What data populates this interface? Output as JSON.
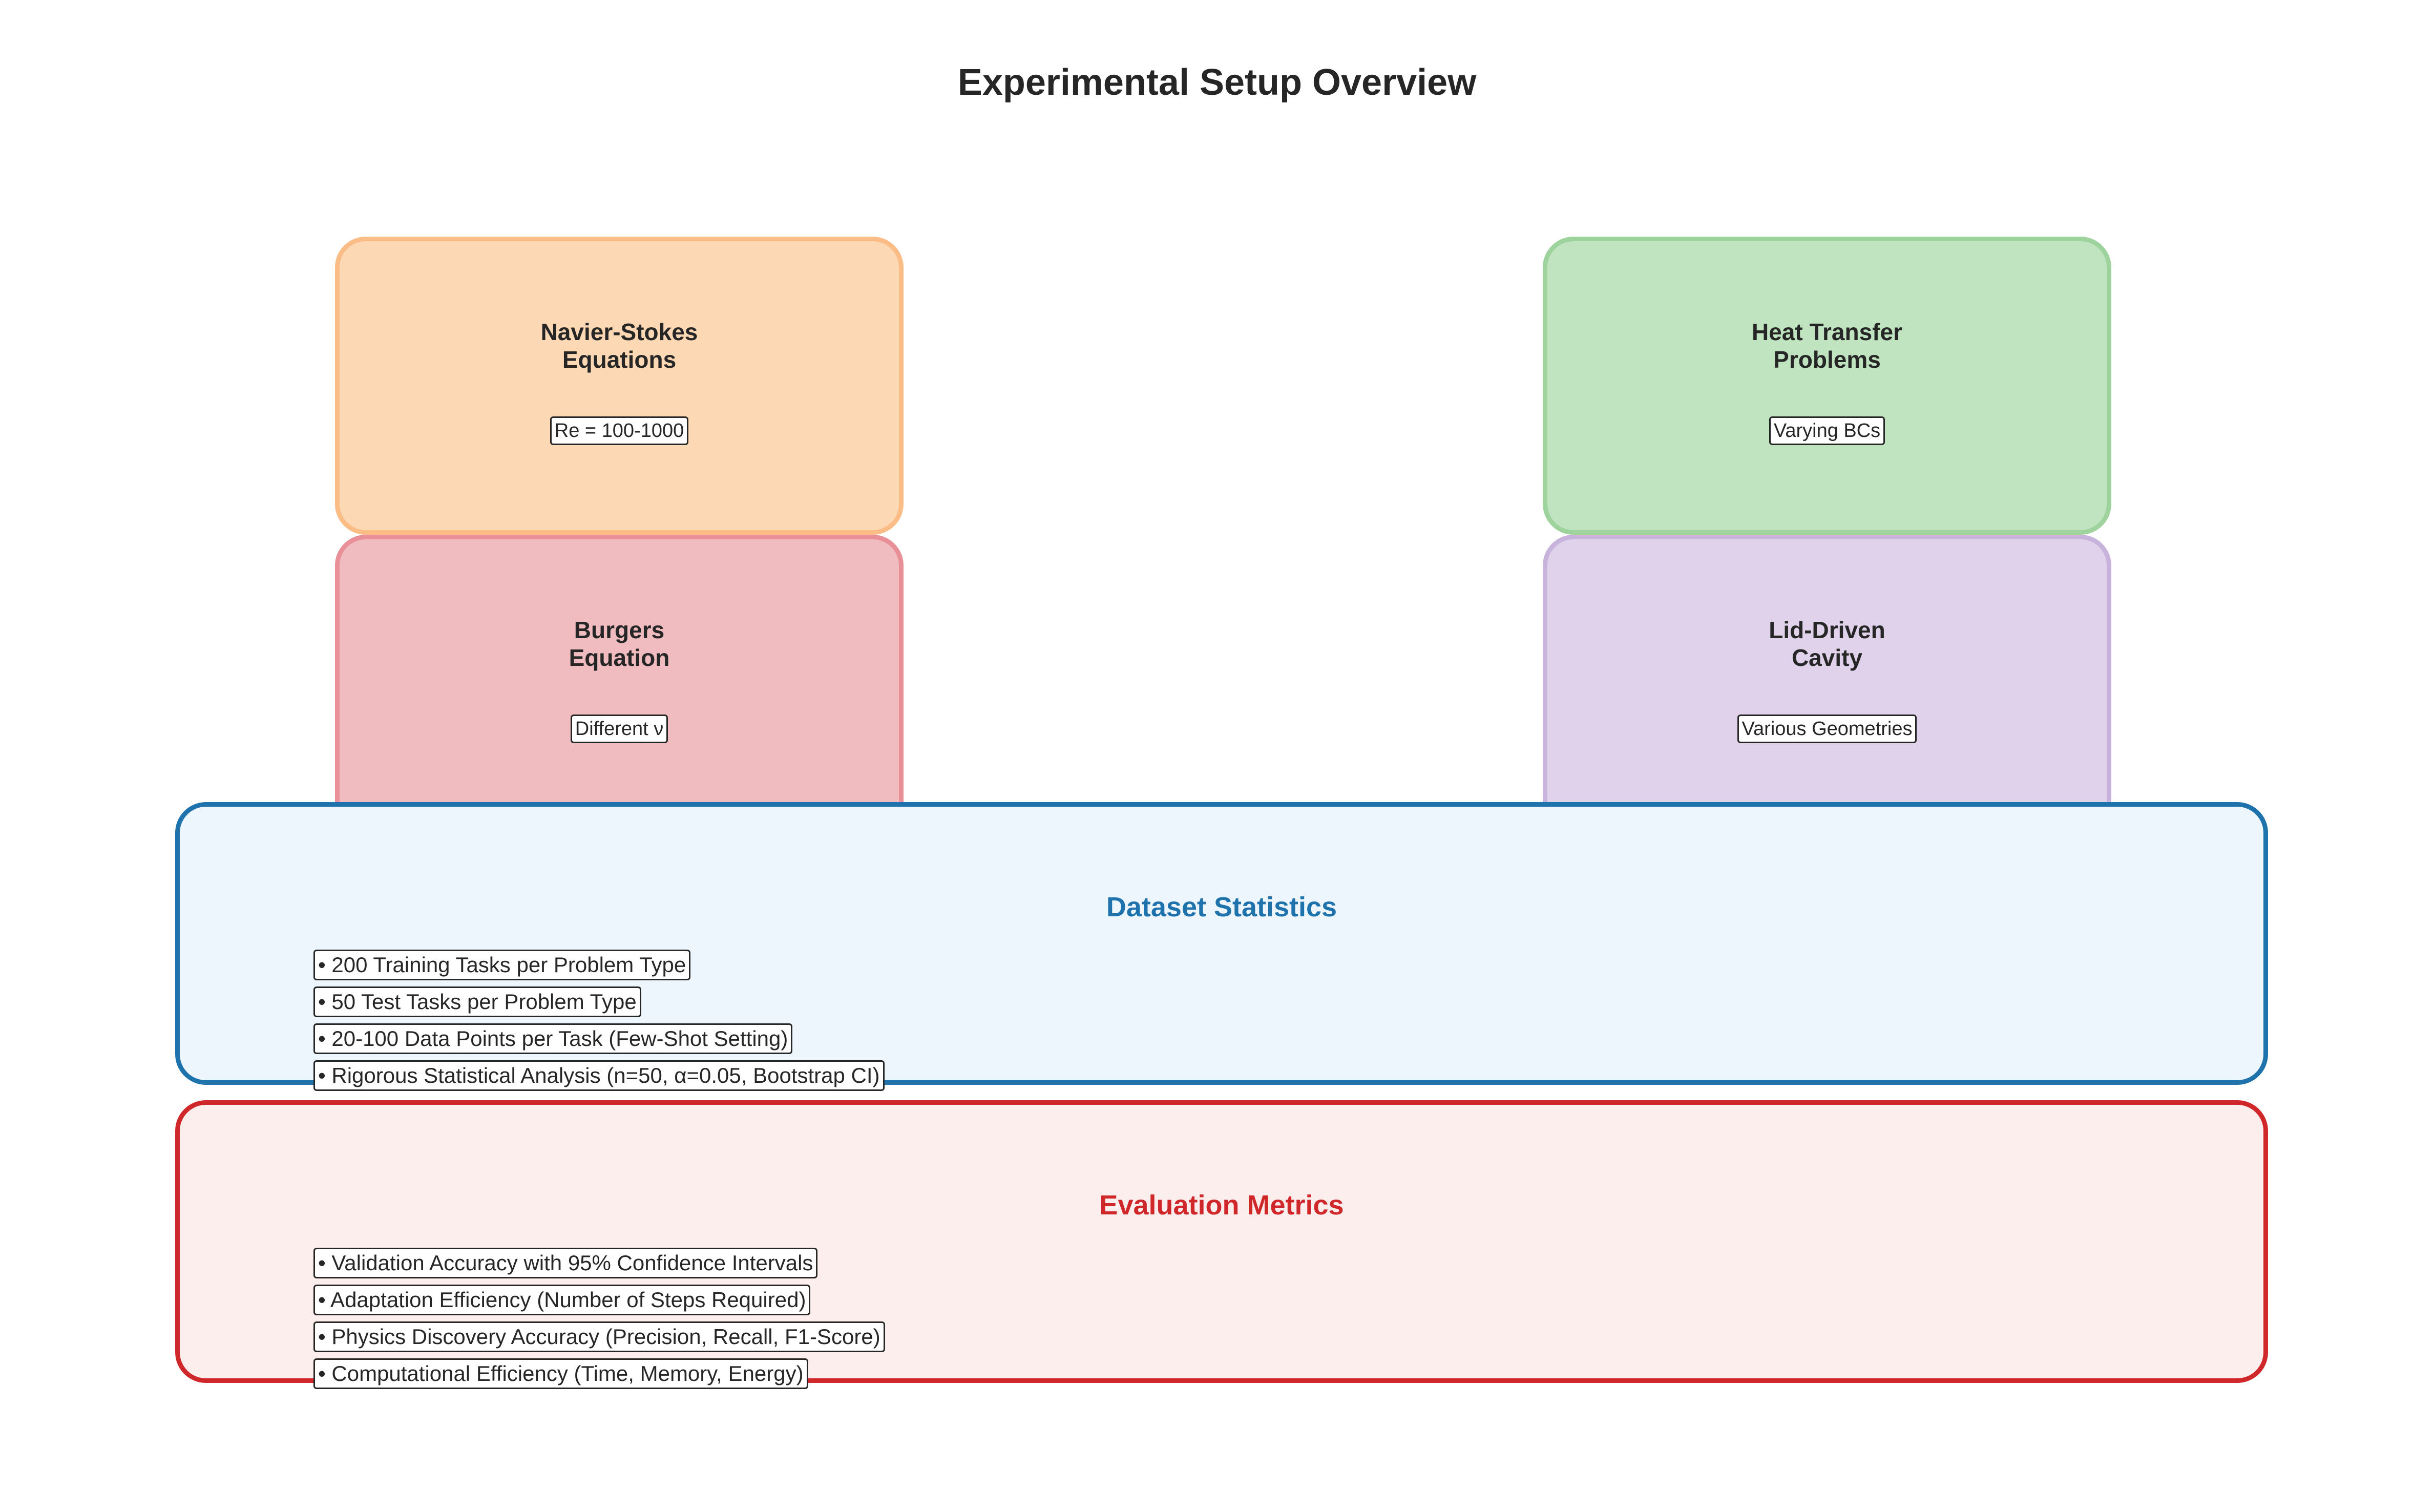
{
  "title": "Experimental Setup Overview",
  "problems": [
    {
      "name": "navier-stokes",
      "line1": "Navier-Stokes",
      "line2": "Equations",
      "tag": "Re = 100-1000",
      "fill": "#fdd8b4",
      "border": "#fcbc86"
    },
    {
      "name": "heat-transfer",
      "line1": "Heat Transfer",
      "line2": "Problems",
      "tag": "Varying BCs",
      "fill": "#c0e3c0",
      "border": "#9fd39e"
    },
    {
      "name": "burgers",
      "line1": "Burgers",
      "line2": "Equation",
      "tag": "Different ν",
      "fill": "#f1bcbf",
      "border": "#e98f98"
    },
    {
      "name": "lid-driven",
      "line1": "Lid-Driven",
      "line2": "Cavity",
      "tag": "Various Geometries",
      "fill": "#dfd2ea",
      "border": "#c7b3dc"
    }
  ],
  "dataset": {
    "title": "Dataset Statistics",
    "color": "#1f73ad",
    "fill": "#eef6fd",
    "items": [
      "• 200 Training Tasks per Problem Type",
      "• 50 Test Tasks per Problem Type",
      "• 20-100 Data Points per Task (Few-Shot Setting)",
      "• Rigorous Statistical Analysis (n=50, α=0.05, Bootstrap CI)"
    ]
  },
  "metrics": {
    "title": "Evaluation Metrics",
    "color": "#d0272b",
    "fill": "#fdeeee",
    "items": [
      "• Validation Accuracy with 95% Confidence Intervals",
      "• Adaptation Efficiency (Number of Steps Required)",
      "• Physics Discovery Accuracy (Precision, Recall, F1-Score)",
      "• Computational Efficiency (Time, Memory, Energy)"
    ]
  }
}
